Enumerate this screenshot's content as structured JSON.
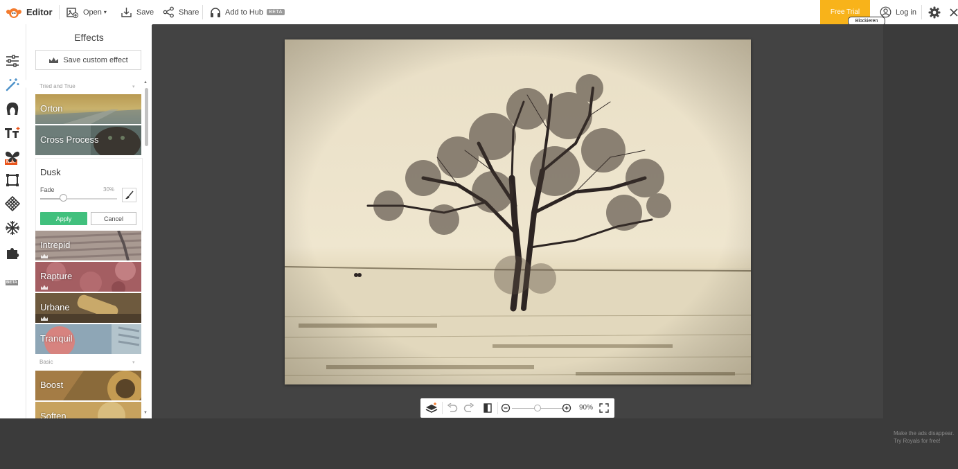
{
  "app": {
    "title": "Editor"
  },
  "toolbar": {
    "open_label": "Open",
    "save_label": "Save",
    "share_label": "Share",
    "hub_label": "Add to Hub",
    "hub_badge": "BETA",
    "free_trial_label": "Free Trial",
    "block_tooltip": "Blockieren",
    "login_label": "Log in"
  },
  "rail": {
    "icons": [
      "adjust-icon",
      "effects-icon",
      "touch-up-icon",
      "text-icon",
      "overlays-icon",
      "frames-icon",
      "textures-icon",
      "themes-icon",
      "stickers-icon"
    ],
    "new_tag": "NEW",
    "beta_tag": "BETA"
  },
  "panel": {
    "title": "Effects",
    "save_custom_label": "Save custom effect",
    "sections": [
      {
        "name": "Tried and True",
        "effects": [
          {
            "label": "Orton",
            "premium": false
          },
          {
            "label": "Cross Process",
            "premium": false
          },
          {
            "label": "Dusk",
            "expanded": true
          },
          {
            "label": "Intrepid",
            "premium": true
          },
          {
            "label": "Rapture",
            "premium": true
          },
          {
            "label": "Urbane",
            "premium": true
          },
          {
            "label": "Tranquil",
            "premium": false
          }
        ]
      },
      {
        "name": "Basic",
        "effects": [
          {
            "label": "Boost",
            "premium": false
          },
          {
            "label": "Soften",
            "premium": false
          }
        ]
      }
    ],
    "dusk": {
      "name": "Dusk",
      "fade_label": "Fade",
      "fade_value": "30%",
      "fade_fraction": 0.3,
      "apply_label": "Apply",
      "cancel_label": "Cancel"
    }
  },
  "canvas": {
    "zoom_label": "90%",
    "zoom_fraction": 0.5
  },
  "ad": {
    "line1": "Make the ads disappear.",
    "line2": "Try Royals for free!"
  },
  "colors": {
    "accent_green": "#41c07d",
    "free_trial": "#f8b31a",
    "new_badge": "#e9551c",
    "canvas_bg": "#434343"
  }
}
